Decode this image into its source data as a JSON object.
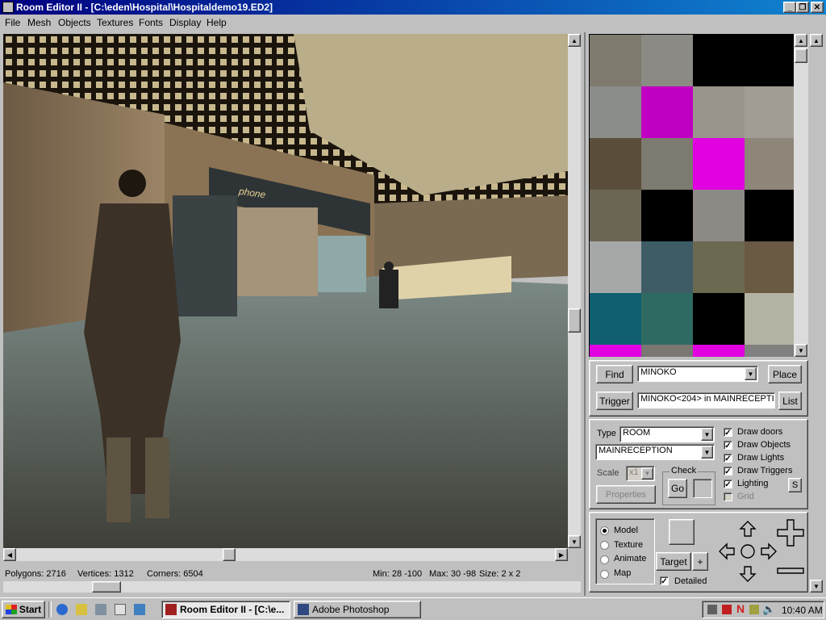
{
  "window": {
    "title": "Room Editor II - [C:\\eden\\Hospital\\Hospitaldemo19.ED2]"
  },
  "menu": [
    "File",
    "Mesh",
    "Objects",
    "Textures",
    "Fonts",
    "Display",
    "Help"
  ],
  "viewport": {
    "sign_text": "phone"
  },
  "status": {
    "polygons": "Polygons: 2716",
    "vertices": "Vertices: 1312",
    "corners": "Corners: 6504",
    "min": "Min: 28 -100",
    "max": "Max: 30 -98",
    "size": "Size: 2 x 2"
  },
  "texture_colors": [
    [
      "#7e7a6e",
      "#8b8a84",
      "#000000",
      "#000000"
    ],
    [
      "#8a8d88",
      "#c000c0",
      "#9a958c",
      "#a29d94"
    ],
    [
      "#5a4e3a",
      "#7d7a70",
      "#e000e0",
      "#8e8679"
    ],
    [
      "#6b6654",
      "#000000",
      "#8d8a86",
      "#000000"
    ],
    [
      "#a6a8a8",
      "#3e5c66",
      "#6b6a50",
      "#6a5a44"
    ],
    [
      "#0f5f70",
      "#2f6a62",
      "#000000",
      "#b4b2a2"
    ],
    [
      "#e000e0",
      "#7a7672",
      "#e000e0",
      "#808080"
    ]
  ],
  "find": {
    "find_label": "Find",
    "object_value": "MINOKO",
    "place_label": "Place",
    "trigger_label": "Trigger",
    "trigger_value": "MINOKO<204> in MAINRECEPTI",
    "list_label": "List"
  },
  "props": {
    "type_label": "Type",
    "type_value": "ROOM",
    "room_value": "MAINRECEPTION",
    "scale_label": "Scale",
    "scale_value": "x1",
    "check_label": "Check",
    "go_label": "Go",
    "properties_label": "Properties",
    "draw_doors": "Draw doors",
    "draw_objects": "Draw Objects",
    "draw_lights": "Draw Lights",
    "draw_triggers": "Draw Triggers",
    "lighting": "Lighting",
    "grid": "Grid",
    "s_label": "S"
  },
  "mode": {
    "model": "Model",
    "texture": "Texture",
    "animate": "Animate",
    "map": "Map",
    "target_label": "Target",
    "plus_label": "+",
    "detailed": "Detailed"
  },
  "taskbar": {
    "start": "Start",
    "task1": "Room Editor II - [C:\\e...",
    "task2": "Adobe Photoshop",
    "clock": "10:40 AM"
  },
  "colors": {
    "title_bar": "#000080",
    "magenta": "#e000e0"
  }
}
